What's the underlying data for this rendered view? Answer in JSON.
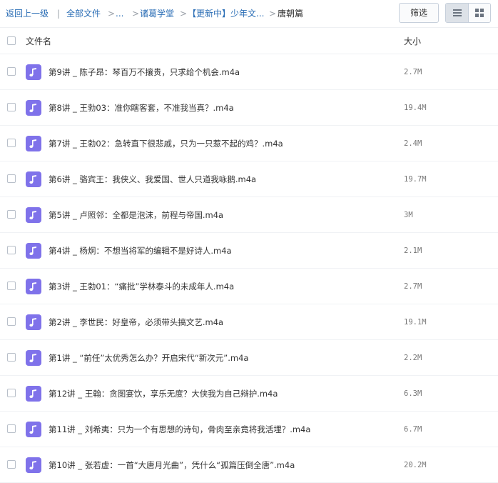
{
  "breadcrumb": {
    "back": "返回上一级",
    "sep1": "|",
    "all_files": "全部文件",
    "sep2": ">",
    "ellipsis": "...",
    "sep3": ">",
    "folder1": "诸葛学堂",
    "sep4": ">",
    "folder2": "【更新中】少年文...",
    "sep5": ">",
    "current": "唐朝篇"
  },
  "toolbar": {
    "filter_label": "筛选",
    "view_list_icon": "list-view-icon",
    "view_grid_icon": "grid-view-icon"
  },
  "table": {
    "col_name": "文件名",
    "col_size": "大小"
  },
  "files": [
    {
      "name": "第9讲 _ 陈子昂：琴百万不攘贵，只求给个机会.m4a",
      "size": "2.7M"
    },
    {
      "name": "第8讲 _ 王勃03：准你瞎客套，不准我当真？.m4a",
      "size": "19.4M"
    },
    {
      "name": "第7讲 _ 王勃02：急转直下很悲戚，只为一只惹不起的鸡？.m4a",
      "size": "2.4M"
    },
    {
      "name": "第6讲 _ 骆宾王：我侠义、我爱国、世人只道我咏鹅.m4a",
      "size": "19.7M"
    },
    {
      "name": "第5讲 _ 卢照邻：全都是泡沫，前程与帝国.m4a",
      "size": "3M"
    },
    {
      "name": "第4讲 _ 杨炯：不想当将军的编辑不是好诗人.m4a",
      "size": "2.1M"
    },
    {
      "name": "第3讲 _ 王勃01：“痛批”学林泰斗的未成年人.m4a",
      "size": "2.7M"
    },
    {
      "name": "第2讲 _ 李世民：好皇帝，必须带头搞文艺.m4a",
      "size": "19.1M"
    },
    {
      "name": "第1讲 _ “前任”太优秀怎么办？开启宋代“新次元”.m4a",
      "size": "2.2M"
    },
    {
      "name": "第12讲 _ 王翰：贪图宴饮，享乐无度？大侠我为自己辩护.m4a",
      "size": "6.3M"
    },
    {
      "name": "第11讲 _ 刘希夷：只为一个有思想的诗句，骨肉至亲竟将我活埋？.m4a",
      "size": "6.7M"
    },
    {
      "name": "第10讲 _ 张若虚：一首“大唐月光曲”，凭什么“孤篇压倒全唐”.m4a",
      "size": "20.2M"
    }
  ],
  "file_icon": "music-file-icon",
  "colors": {
    "link": "#2a6db5",
    "file_icon_bg": "#7f72ea",
    "active_view_bg": "#dde2e8"
  }
}
